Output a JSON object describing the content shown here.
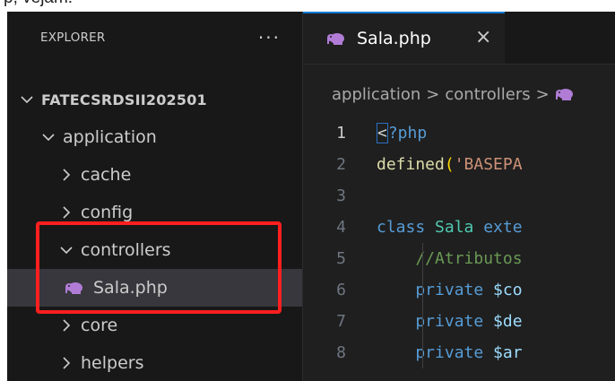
{
  "caption": "p, vejam:",
  "sidebar": {
    "title": "EXPLORER",
    "more_icon": "more-actions-icon",
    "tree": [
      {
        "label": "FATECSRDSII202501",
        "depth": 0,
        "expanded": true,
        "root": true
      },
      {
        "label": "application",
        "depth": 1,
        "expanded": true
      },
      {
        "label": "cache",
        "depth": 2,
        "expanded": false
      },
      {
        "label": "config",
        "depth": 2,
        "expanded": false
      },
      {
        "label": "controllers",
        "depth": 2,
        "expanded": true
      },
      {
        "label": "Sala.php",
        "depth": 3,
        "file": true,
        "selected": true
      },
      {
        "label": "core",
        "depth": 2,
        "expanded": false
      },
      {
        "label": "helpers",
        "depth": 2,
        "expanded": false
      }
    ]
  },
  "editor": {
    "tab": {
      "label": "Sala.php",
      "close": "×"
    },
    "breadcrumb": [
      "application",
      "controllers"
    ],
    "lines": [
      {
        "n": "1",
        "active": true,
        "tokens": [
          {
            "t": "<",
            "c": "#d4d4d4",
            "cursor": true
          },
          {
            "t": "?php",
            "c": "#569cd6"
          }
        ]
      },
      {
        "n": "2",
        "tokens": [
          {
            "t": "defined",
            "c": "#dcdcaa"
          },
          {
            "t": "(",
            "c": "#ffd700"
          },
          {
            "t": "'BASEPA",
            "c": "#ce9178"
          }
        ]
      },
      {
        "n": "3",
        "tokens": []
      },
      {
        "n": "4",
        "tokens": [
          {
            "t": "class ",
            "c": "#569cd6"
          },
          {
            "t": "Sala ",
            "c": "#4ec9b0"
          },
          {
            "t": "exte",
            "c": "#569cd6"
          }
        ]
      },
      {
        "n": "5",
        "guide": true,
        "tokens": [
          {
            "t": "    //Atributos",
            "c": "#6a9955"
          }
        ]
      },
      {
        "n": "6",
        "guide": true,
        "tokens": [
          {
            "t": "    private ",
            "c": "#569cd6"
          },
          {
            "t": "$co",
            "c": "#9cdcfe"
          }
        ]
      },
      {
        "n": "7",
        "guide": true,
        "tokens": [
          {
            "t": "    private ",
            "c": "#569cd6"
          },
          {
            "t": "$de",
            "c": "#9cdcfe"
          }
        ]
      },
      {
        "n": "8",
        "guide": true,
        "tokens": [
          {
            "t": "    private ",
            "c": "#569cd6"
          },
          {
            "t": "$ar",
            "c": "#9cdcfe"
          }
        ]
      }
    ]
  },
  "colors": {
    "accent": "#0078d4",
    "highlight_box": "#ff1f1f",
    "php_icon": "#b07cd6"
  }
}
